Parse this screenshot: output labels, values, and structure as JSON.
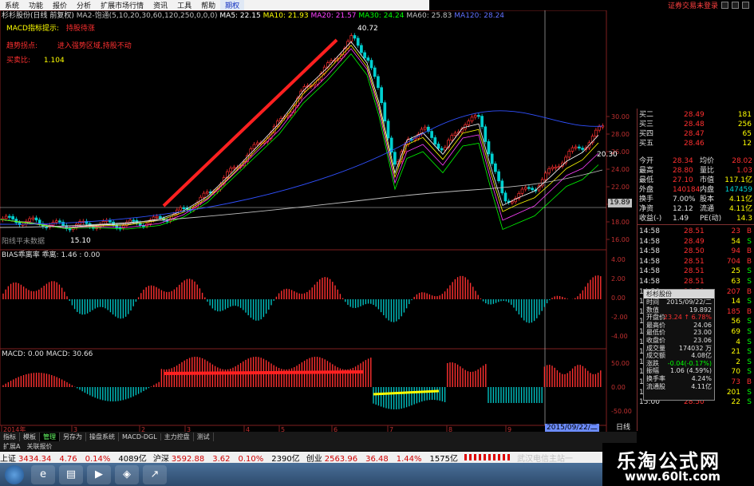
{
  "menu": {
    "items": [
      "系统",
      "功能",
      "报价",
      "分析",
      "扩展市场行情",
      "资讯",
      "工具",
      "帮助",
      "期权"
    ],
    "alert": "证券交易未登录"
  },
  "chart": {
    "title": "杉杉股份(日线 前复权)",
    "ma_label": "MA2-饱通(5,10,20,30,60,120,250,0,0,0)",
    "ma": [
      {
        "label": "MA5: 22.15",
        "color": "#ffffff"
      },
      {
        "label": "MA10: 21.93",
        "color": "#ffff00"
      },
      {
        "label": "MA20: 21.57",
        "color": "#ff40ff"
      },
      {
        "label": "MA30: 24.24",
        "color": "#00ff00"
      },
      {
        "label": "MA60: 25.83",
        "color": "#c0c0c0"
      },
      {
        "label": "MA120: 28.24",
        "color": "#4060ff"
      }
    ],
    "macd_hint": "MACD指标提示:",
    "macd_hint_value": "持股待涨",
    "cross_label": "趋势拐点:",
    "cross_value": "进入强势区域,持股不动",
    "ratio_label": "买卖比:",
    "ratio_value": "1.104",
    "peak_label": "40.72",
    "low_label": "15.10",
    "last_label": "20.30",
    "current_price_tag": "19.89",
    "main_yaxis": [
      "30.00",
      "28.00",
      "26.00",
      "24.00",
      "22.00",
      "20.00",
      "18.00",
      "16.00"
    ],
    "bias_label": "BIAS乖离率 乖离: 1.46",
    "bias_value": ": 0.00",
    "bias_yaxis": [
      "4.00",
      "2.00",
      "0.00",
      "-2.00",
      "-4.00"
    ],
    "macd_label": "MACD: 0.00 MACD: 30.66",
    "macd_yaxis": [
      "50.00",
      "0.00",
      "-50.00"
    ],
    "x_labels": [
      "2014年",
      "3",
      "2",
      "3",
      "4",
      "5",
      "6",
      "7",
      "8",
      "9"
    ],
    "date_tag": "2015/09/22/二",
    "bottom_right_label": "日线",
    "vol_note": "阳线平未数据"
  },
  "quote": {
    "rows": [
      {
        "l": "买二",
        "v": "28.49",
        "c": "181"
      },
      {
        "l": "买三",
        "v": "28.48",
        "c": "256"
      },
      {
        "l": "买四",
        "v": "28.47",
        "c": "65"
      },
      {
        "l": "买五",
        "v": "28.46",
        "c": "12"
      }
    ],
    "stats": [
      {
        "l1": "今开",
        "v1": "28.34",
        "l2": "均价",
        "v2": "28.02"
      },
      {
        "l1": "最高",
        "v1": "28.80",
        "l2": "量比",
        "v2": "1.03"
      },
      {
        "l1": "最低",
        "v1": "27.10",
        "l2": "市值",
        "v2": "117.1亿"
      },
      {
        "l1": "外盘",
        "v1": "140184",
        "l2": "内盘",
        "v2": "147459"
      },
      {
        "l1": "换手",
        "v1": "7.00%",
        "l2": "股本",
        "v2": "4.11亿"
      },
      {
        "l1": "净资",
        "v1": "12.12",
        "l2": "流通",
        "v2": "4.11亿"
      },
      {
        "l1": "收益(-)",
        "v1": "1.49",
        "l2": "PE(动)",
        "v2": "14.3"
      }
    ],
    "ticks": [
      {
        "t": "14:58",
        "p": "28.51",
        "v": "23",
        "f": "B"
      },
      {
        "t": "14:58",
        "p": "28.49",
        "v": "54",
        "f": "S"
      },
      {
        "t": "14:58",
        "p": "28.50",
        "v": "94",
        "f": "B"
      },
      {
        "t": "14:58",
        "p": "28.51",
        "v": "704",
        "f": "B"
      },
      {
        "t": "14:58",
        "p": "28.51",
        "v": "25",
        "f": "S"
      },
      {
        "t": "14:58",
        "p": "28.51",
        "v": "63",
        "f": "S"
      },
      {
        "t": "14:58",
        "p": "28.50",
        "v": "207",
        "f": "B"
      },
      {
        "t": "14:58",
        "p": "28.50",
        "v": "14",
        "f": "S"
      },
      {
        "t": "14:58",
        "p": "28.50",
        "v": "185",
        "f": "B"
      },
      {
        "t": "14:58",
        "p": "28.50",
        "v": "56",
        "f": "S"
      },
      {
        "t": "14:58",
        "p": "28.50",
        "v": "69",
        "f": "S"
      },
      {
        "t": "14:58",
        "p": "28.50",
        "v": "4",
        "f": "S"
      },
      {
        "t": "14:58",
        "p": "28.50",
        "v": "21",
        "f": "S"
      },
      {
        "t": "14:59",
        "p": "28.50",
        "v": "2",
        "f": "S"
      },
      {
        "t": "14:59",
        "p": "28.50",
        "v": "70",
        "f": "S"
      },
      {
        "t": "14:59",
        "p": "28.50",
        "v": "73",
        "f": "B"
      },
      {
        "t": "14:59",
        "p": "28.50",
        "v": "201",
        "f": "S"
      },
      {
        "t": "15:00",
        "p": "28.50",
        "v": "22",
        "f": "S"
      }
    ]
  },
  "popup": {
    "title": "杉杉股份",
    "rows": [
      {
        "l": "时间",
        "v": "2015/09/22/二"
      },
      {
        "l": "数值",
        "v": "19.892"
      },
      {
        "l": "开盘价",
        "v": "23.24 ↑ 6.78%"
      },
      {
        "l": "最高价",
        "v": "24.06"
      },
      {
        "l": "最低价",
        "v": "23.00"
      },
      {
        "l": "收盘价",
        "v": "23.06"
      },
      {
        "l": "成交量",
        "v": "174032 万"
      },
      {
        "l": "成交额",
        "v": "4.08亿"
      },
      {
        "l": "涨跌",
        "v": "-0.04(-0.17%)"
      },
      {
        "l": "振幅",
        "v": "1.06 (4.59%)"
      },
      {
        "l": "换手率",
        "v": "4.24%"
      },
      {
        "l": "流通股",
        "v": "4.11亿"
      }
    ]
  },
  "tabs": {
    "row1": [
      "指标",
      "模板",
      "管理",
      "另存为",
      "操盘系统",
      "MACD-DGL",
      "主力控盘",
      "测试"
    ],
    "active": "管理",
    "row2": [
      "扩展A",
      "关联报价"
    ]
  },
  "status": {
    "items": [
      {
        "name": "上证",
        "val": "3434.34",
        "chg": "4.76",
        "pct": "0.14%",
        "amt": "4089亿"
      },
      {
        "name": "沪深",
        "val": "3592.88",
        "chg": "3.62",
        "pct": "0.10%",
        "amt": "2390亿"
      },
      {
        "name": "创业",
        "val": "2563.96",
        "chg": "36.48",
        "pct": "1.44%",
        "amt": "1575亿"
      }
    ],
    "server": "武汉电信主站一"
  },
  "watermark": {
    "title": "乐淘公式网",
    "url": "www.60lt.com"
  },
  "colors": {
    "up": "#ff3030",
    "down": "#00c0c0",
    "grid": "#802020",
    "yellow": "#ffff00",
    "green": "#00ff00"
  }
}
